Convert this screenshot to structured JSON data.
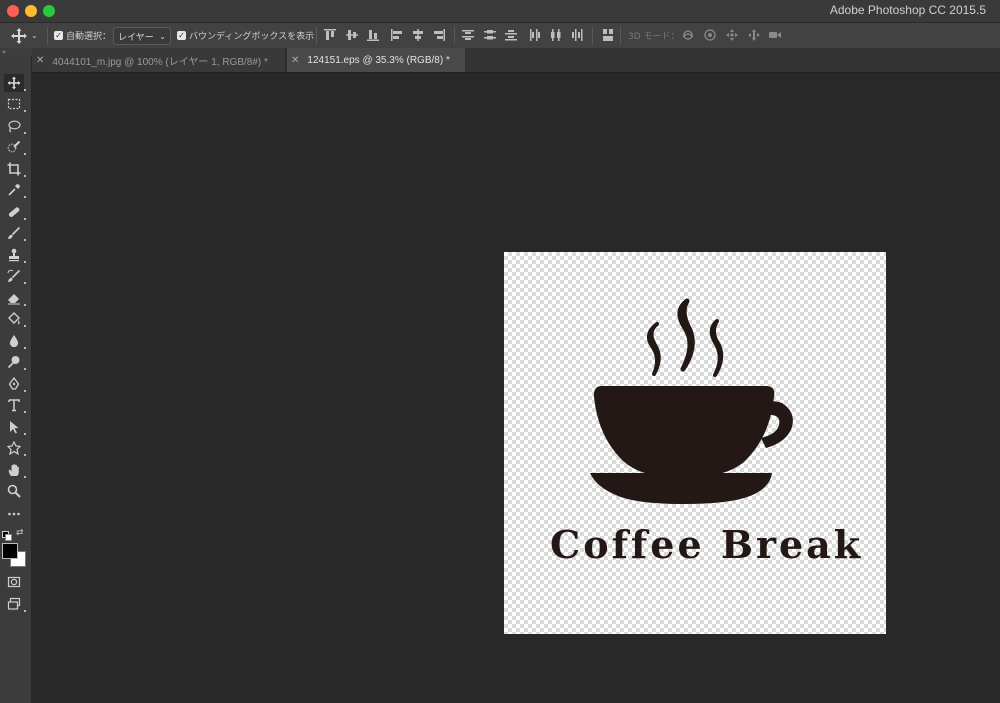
{
  "window": {
    "app_title": "Adobe Photoshop CC 2015.5"
  },
  "options_bar": {
    "auto_select_label": "自動選択：",
    "auto_select_checked": true,
    "auto_select_target": "レイヤー",
    "show_bounding_box_label": "バウンディングボックスを表示",
    "show_bounding_box_checked": true,
    "mode_3d_label": "3D モード："
  },
  "tabs": [
    {
      "label": "4044101_m.jpg @ 100% (レイヤー 1, RGB/8#) *",
      "active": false
    },
    {
      "label": "124151.eps @ 35.3% (RGB/8) *",
      "active": true
    }
  ],
  "tools": [
    "move-tool-icon",
    "marquee-tool-icon",
    "lasso-tool-icon",
    "quick-selection-icon",
    "crop-tool-icon",
    "eyedropper-icon",
    "healing-brush-icon",
    "brush-icon",
    "clone-stamp-icon",
    "history-brush-icon",
    "eraser-icon",
    "paint-bucket-icon",
    "blur-icon",
    "dodge-icon",
    "pen-icon",
    "type-icon",
    "path-selection-icon",
    "custom-shape-icon",
    "hand-icon",
    "zoom-icon",
    "more-tools-icon",
    "foreground-background-icon",
    "quick-mask-icon",
    "screen-mode-icon"
  ],
  "colors": {
    "foreground": "#000000",
    "background": "#ffffff",
    "artwork": "#231815"
  },
  "document": {
    "artwork_text": "Coffee Break"
  }
}
